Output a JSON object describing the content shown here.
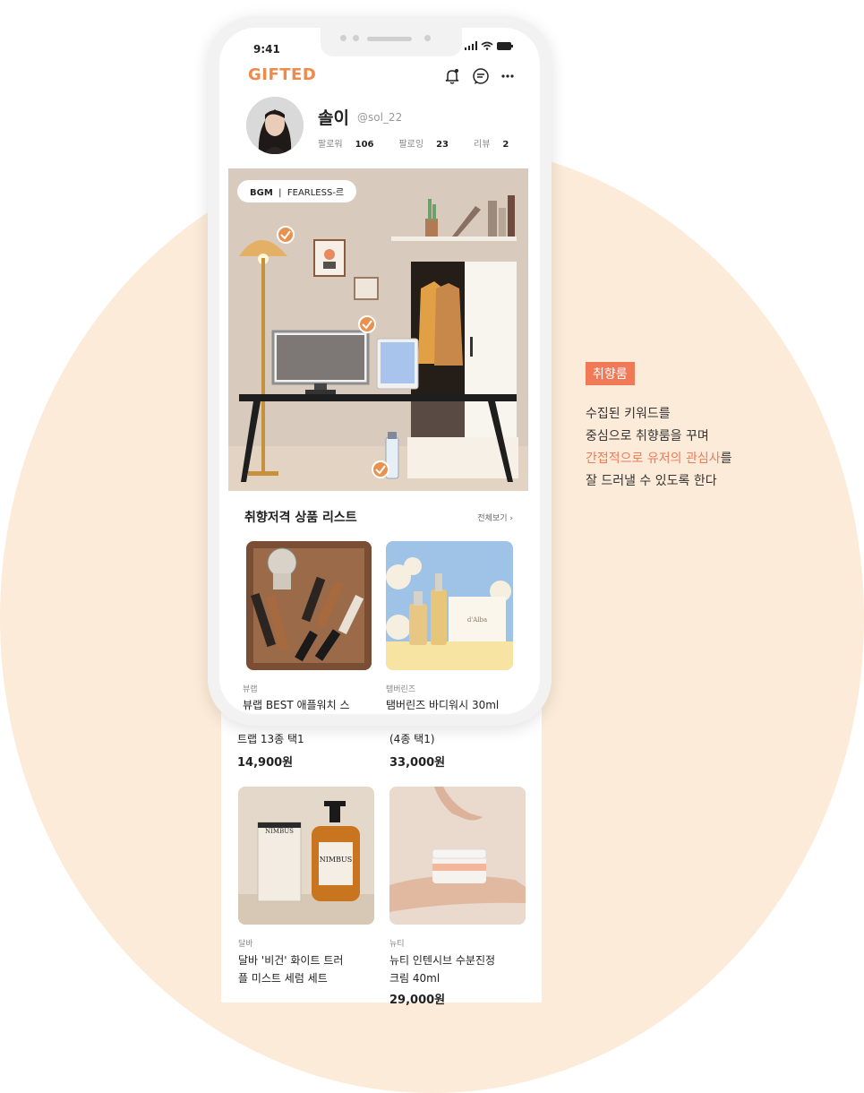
{
  "status": {
    "time": "9:41"
  },
  "header": {
    "logo": "GIFTED"
  },
  "profile": {
    "name": "솔이",
    "handle": "@sol_22",
    "followers_label": "팔로워",
    "followers": "106",
    "following_label": "팔로잉",
    "following": "23",
    "reviews_label": "리뷰",
    "reviews": "2"
  },
  "room": {
    "bgm_label": "BGM",
    "bgm_title": "FEARLESS-르"
  },
  "list": {
    "title": "취향저격 상품 리스트",
    "see_all": "전체보기",
    "products": [
      {
        "brand": "뷰랩",
        "name_1": "뷰랩 BEST 애플워치 스",
        "name_2": "트랩 13종 택1",
        "price": "14,900원"
      },
      {
        "brand": "탬버린즈",
        "name_1": "탬버린즈 바디워시 30ml",
        "name_2": "(4종 택1)",
        "price": "33,000원"
      },
      {
        "brand": "달바",
        "name_1": "달바 '비건' 화이트 트러",
        "name_2": "플 미스트 세럼 세트",
        "price": ""
      },
      {
        "brand": "뉴티",
        "name_1": "뉴티 인텐시브 수분진정",
        "name_2": "크림 40ml",
        "price": "29,000원"
      }
    ]
  },
  "side": {
    "tag": "취향룸",
    "line1": "수집된 키워드를",
    "line2": "중심으로 취향룸을 꾸며",
    "line3_hl": "간접적으로 유저의 관심사",
    "line3_end": "를",
    "line4": "잘 드러낼 수 있도록 한다"
  },
  "colors": {
    "accent": "#f07a58",
    "logo": "#f08a4b",
    "background_circle": "#fcebd8"
  }
}
